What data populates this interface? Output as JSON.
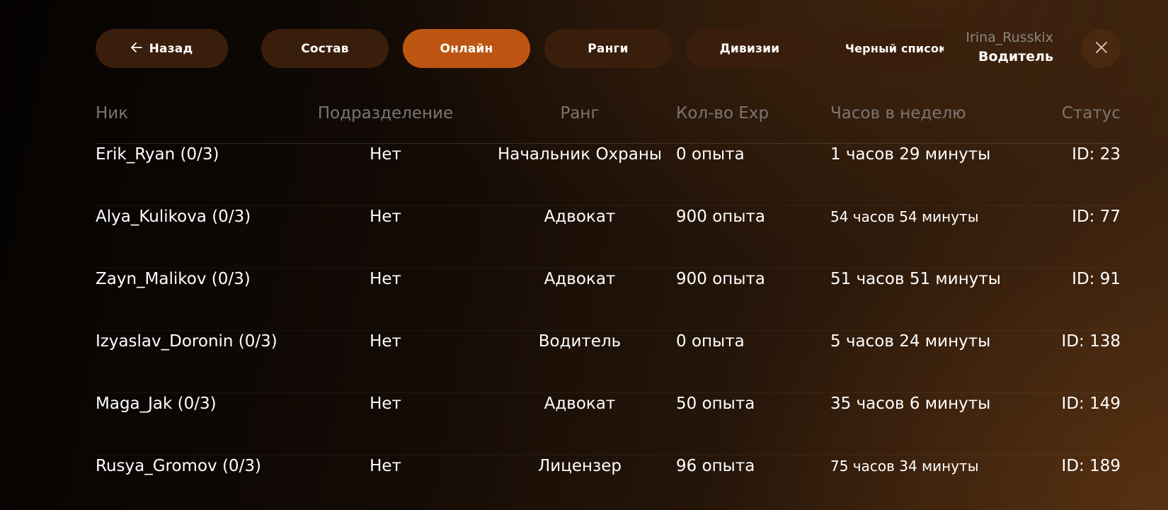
{
  "nav": {
    "back_label": "Назад",
    "back_icon": "arrow-left-icon",
    "tabs": [
      {
        "label": "Состав",
        "active": false
      },
      {
        "label": "Онлайн",
        "active": true
      },
      {
        "label": "Ранги",
        "active": false
      },
      {
        "label": "Дивизии",
        "active": false
      },
      {
        "label": "Черный список",
        "active": false
      }
    ]
  },
  "user": {
    "name": "Irina_Russkix",
    "role": "Водитель"
  },
  "close_icon": "close-icon",
  "colors": {
    "accent": "#bd5512",
    "pill": "#3a1e0c",
    "header_text": "#7c7672"
  },
  "table": {
    "headers": [
      "Ник",
      "Подразделение",
      "Ранг",
      "Кол-во Exp",
      "Часов в неделю",
      "Статус"
    ],
    "rows": [
      {
        "nick": "Erik_Ryan (0/3)",
        "division": "Нет",
        "rank": "Начальник Охраны",
        "exp": "0 опыта",
        "hours": "1 часов 29 минуты",
        "status": "ID: 23"
      },
      {
        "nick": "Alya_Kulikova (0/3)",
        "division": "Нет",
        "rank": "Адвокат",
        "exp": "900 опыта",
        "hours": "54 часов 54 минуты",
        "status": "ID: 77"
      },
      {
        "nick": "Zayn_Malikov (0/3)",
        "division": "Нет",
        "rank": "Адвокат",
        "exp": "900 опыта",
        "hours": "51 часов 51 минуты",
        "status": "ID: 91"
      },
      {
        "nick": "Izyaslav_Doronin (0/3)",
        "division": "Нет",
        "rank": "Водитель",
        "exp": "0 опыта",
        "hours": "5 часов 24 минуты",
        "status": "ID: 138"
      },
      {
        "nick": "Maga_Jak (0/3)",
        "division": "Нет",
        "rank": "Адвокат",
        "exp": "50 опыта",
        "hours": "35 часов 6 минуты",
        "status": "ID: 149"
      },
      {
        "nick": "Rusya_Gromov (0/3)",
        "division": "Нет",
        "rank": "Лицензер",
        "exp": "96 опыта",
        "hours": "75 часов 34 минуты",
        "status": "ID: 189"
      }
    ]
  }
}
